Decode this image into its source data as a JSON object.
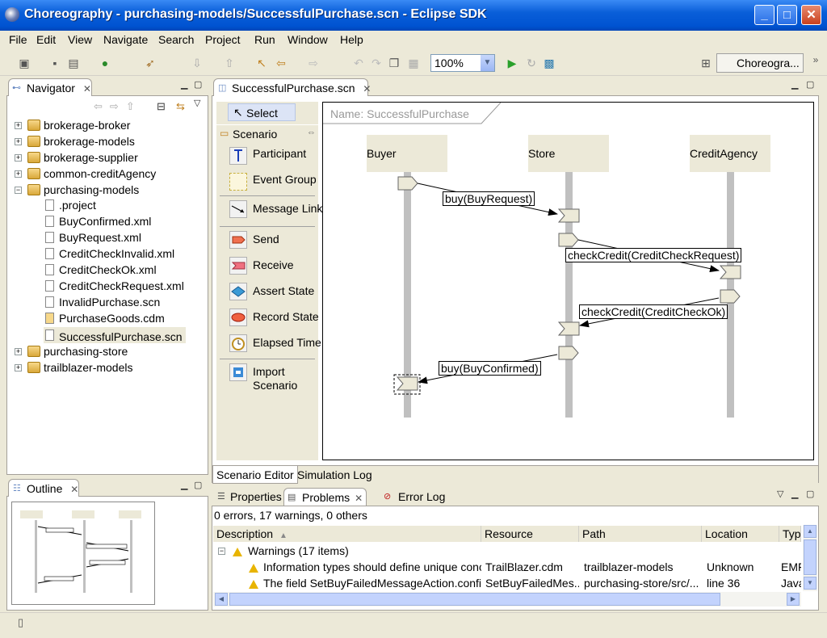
{
  "window": {
    "title": "Choreography - purchasing-models/SuccessfulPurchase.scn - Eclipse SDK",
    "minimize": "_",
    "maximize": "□",
    "close": "✕"
  },
  "menu": [
    "File",
    "Edit",
    "View",
    "Navigate",
    "Search",
    "Project",
    "Run",
    "Window",
    "Help"
  ],
  "toolbar": {
    "zoom": "100%",
    "perspective": "Choreogra..."
  },
  "navigator": {
    "title": "Navigator",
    "items": [
      {
        "label": "brokerage-broker",
        "type": "project",
        "expanded": false
      },
      {
        "label": "brokerage-models",
        "type": "project",
        "expanded": false
      },
      {
        "label": "brokerage-supplier",
        "type": "project",
        "expanded": false
      },
      {
        "label": "common-creditAgency",
        "type": "project",
        "expanded": false
      },
      {
        "label": "purchasing-models",
        "type": "project",
        "expanded": true
      },
      {
        "label": ".project",
        "type": "file"
      },
      {
        "label": "BuyConfirmed.xml",
        "type": "file"
      },
      {
        "label": "BuyRequest.xml",
        "type": "file"
      },
      {
        "label": "CreditCheckInvalid.xml",
        "type": "file"
      },
      {
        "label": "CreditCheckOk.xml",
        "type": "file"
      },
      {
        "label": "CreditCheckRequest.xml",
        "type": "file"
      },
      {
        "label": "InvalidPurchase.scn",
        "type": "file"
      },
      {
        "label": "PurchaseGoods.cdm",
        "type": "file"
      },
      {
        "label": "SuccessfulPurchase.scn",
        "type": "file",
        "selected": true
      },
      {
        "label": "purchasing-store",
        "type": "project",
        "expanded": false
      },
      {
        "label": "trailblazer-models",
        "type": "project",
        "expanded": false
      }
    ]
  },
  "outline": {
    "title": "Outline"
  },
  "editor": {
    "tab": "SuccessfulPurchase.scn",
    "name_label": "Name: SuccessfulPurchase",
    "bottom_tabs": [
      "Scenario Editor",
      "Simulation Log"
    ],
    "palette": {
      "select": "Select",
      "drawer": "Scenario",
      "tools": [
        "Participant",
        "Event Group",
        "Message Link",
        "Send",
        "Receive",
        "Assert State",
        "Record State",
        "Elapsed Time",
        "Import Scenario"
      ]
    },
    "participants": [
      "Buyer",
      "Store",
      "CreditAgency"
    ],
    "messages": [
      "buy(BuyRequest)",
      "checkCredit(CreditCheckRequest)",
      "checkCredit(CreditCheckOk)",
      "buy(BuyConfirmed)"
    ]
  },
  "problems": {
    "tabs": [
      "Properties",
      "Problems",
      "Error Log"
    ],
    "summary": "0 errors, 17 warnings, 0 others",
    "columns": [
      "Description",
      "Resource",
      "Path",
      "Location",
      "Type"
    ],
    "group": "Warnings (17 items)",
    "rows": [
      {
        "description": "Information types should define unique conc",
        "resource": "TrailBlazer.cdm",
        "path": "trailblazer-models",
        "location": "Unknown",
        "type": "EMF"
      },
      {
        "description": "The field SetBuyFailedMessageAction.config is",
        "resource": "SetBuyFailedMes...",
        "path": "purchasing-store/src/...",
        "location": "line 36",
        "type": "Java"
      }
    ]
  },
  "colors": {
    "titlebar": "#0a5fd9",
    "chrome": "#ece9d8",
    "lifeline_head": "#ece9d8"
  }
}
